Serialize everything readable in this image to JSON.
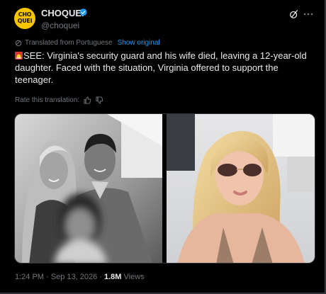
{
  "author": {
    "avatar_line1": "CHO",
    "avatar_line2": "QUEI",
    "name": "CHOQUEI",
    "handle": "@choquei"
  },
  "translation": {
    "note": "Translated from Portuguese",
    "show_original": "Show original"
  },
  "tweet": {
    "text": "SEE: Virginia's security guard and his wife died, leaving a 12-year-old daughter. Faced with the situation, Virginia offered to support the teenager."
  },
  "rate": {
    "label": "Rate this translation:"
  },
  "meta": {
    "time": "1:24 PM",
    "date": "Sep 13, 2026",
    "views_count": "1.8M",
    "views_label": "Views"
  },
  "icons": {
    "verified": "verified-badge-icon",
    "grok": "grok-icon",
    "more": "more-options-icon",
    "translate": "globe-icon",
    "siren": "siren-emoji-icon",
    "thumbs_up": "thumbs-up-icon",
    "thumbs_down": "thumbs-down-icon"
  },
  "colors": {
    "background": "#000000",
    "accent": "#1d9bf0",
    "text": "#e7e9ea",
    "muted": "#71767b",
    "avatar_yellow": "#f6c400"
  }
}
